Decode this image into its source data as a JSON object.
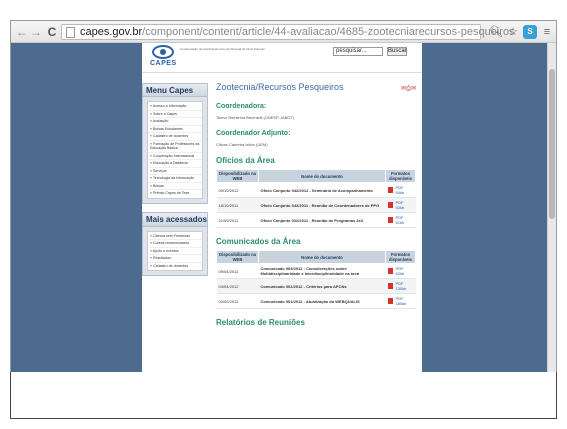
{
  "browser": {
    "url_host": "capes.gov.br",
    "url_path": "/component/content/article/44-avaliacao/4685-zootecniarecursos-pesqueiros"
  },
  "site": {
    "logo_text": "CAPES",
    "tagline": "Coordenação de Aperfeiçoamento de Pessoal de Nível Superior",
    "search_placeholder": "pesquisar...",
    "search_button": "Buscar"
  },
  "menu_capes": {
    "title": "Menu Capes",
    "items": [
      "» Acesso à Informação",
      "» Sobre a Capes",
      "» Avaliação",
      "» Bolsas Estudantes",
      "» Cadastro de docentes",
      "» Formação de Professores da Educação Básica",
      "» Cooperação Internacional",
      "» Educação a Distância",
      "» Serviços",
      "» Tecnologia da Informação",
      "» Bolsas",
      "» Prêmio Capes de Tese"
    ]
  },
  "mais_acessados": {
    "title": "Mais acessados",
    "items": [
      "» Ciência sem Fronteiras",
      "» Cursos recomendados",
      "» Apoio a eventos",
      "» Resultados",
      "» Cadastro de docentes"
    ]
  },
  "main": {
    "page_title": "Zootecnia/Recursos Pesqueiros",
    "coordenadora_heading": "Coordenadora:",
    "coordenadora_name": "Telma Teresinha Berchielli (UNESP-JABOT)",
    "adjunto_heading": "Coordenador Adjunto:",
    "adjunto_name": "Cilivas Cabreira Isbim (UEM)",
    "oficios_heading": "Ofícios da Área",
    "oficios_headers": [
      "Disponibilizado na WEB",
      "Nome do documento",
      "Formatos disponíveis"
    ],
    "oficios_rows": [
      {
        "date": "09/10/2012",
        "doc": "Ofício Conjunto 042/2012 - Seminário de Acompanhamento",
        "fmt": "PDF",
        "size": "54kb"
      },
      {
        "date": "18/10/2011",
        "doc": "Ofício Conjunto 042/2011 - Reunião de Coordenadores de PPG",
        "fmt": "PDF",
        "size": "53kb"
      },
      {
        "date": "21/09/2011",
        "doc": "Ofício Conjunto 022/2011 - Reunião de Programas 3x3",
        "fmt": "PDF",
        "size": "61kb"
      }
    ],
    "comunicados_heading": "Comunicados da Área",
    "comunicados_headers": [
      "Disponibilizado na WEB",
      "Nome do documento",
      "Formatos disponíveis"
    ],
    "comunicados_rows": [
      {
        "date": "09/04/2012",
        "doc": "Comunicado 003/2012 - Considerações sobre Multidisciplinaridade e Interdisciplinaridade na área",
        "fmt": "PDF",
        "size": "62kb"
      },
      {
        "date": "04/04/2012",
        "doc": "Comunicado 002/2012 - Critérios para APCNs",
        "fmt": "PDF",
        "size": "130kb"
      },
      {
        "date": "02/02/2012",
        "doc": "Comunicado 001/2012 - Atualização do WEBQUALIS",
        "fmt": "PDF",
        "size": "180kb"
      }
    ],
    "relatorios_heading": "Relatórios de Reuniões"
  }
}
